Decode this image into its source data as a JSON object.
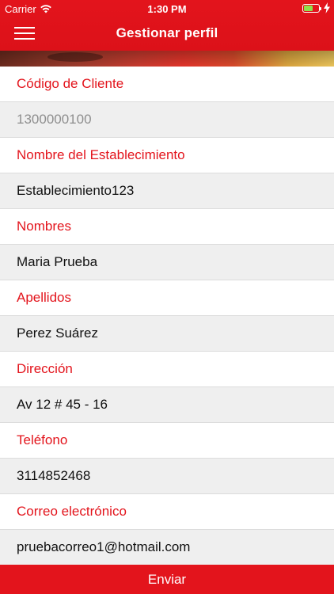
{
  "status_bar": {
    "carrier": "Carrier",
    "time": "1:30 PM",
    "battery_level": 0.6,
    "battery_color": "#8fe04a",
    "icons": [
      "wifi-icon",
      "battery-icon",
      "charging-bolt-icon"
    ]
  },
  "nav": {
    "title": "Gestionar perfil",
    "menu_icon": "hamburger-menu-icon"
  },
  "colors": {
    "accent": "#e3141c",
    "label_text": "#e3141c",
    "value_bg": "#efefef",
    "readonly_text": "#8e8e8e"
  },
  "fields": [
    {
      "label": "Código de Cliente",
      "value": "1300000100",
      "readonly": true
    },
    {
      "label": "Nombre del Establecimiento",
      "value": "Establecimiento123",
      "readonly": false
    },
    {
      "label": "Nombres",
      "value": "Maria Prueba",
      "readonly": false
    },
    {
      "label": "Apellidos",
      "value": "Perez Suárez",
      "readonly": false
    },
    {
      "label": "Dirección",
      "value": "Av 12 # 45 - 16",
      "readonly": false
    },
    {
      "label": "Teléfono",
      "value": "3114852468",
      "readonly": false
    },
    {
      "label": "Correo electrónico",
      "value": "pruebacorreo1@hotmail.com",
      "readonly": false
    }
  ],
  "submit": {
    "label": "Enviar"
  }
}
